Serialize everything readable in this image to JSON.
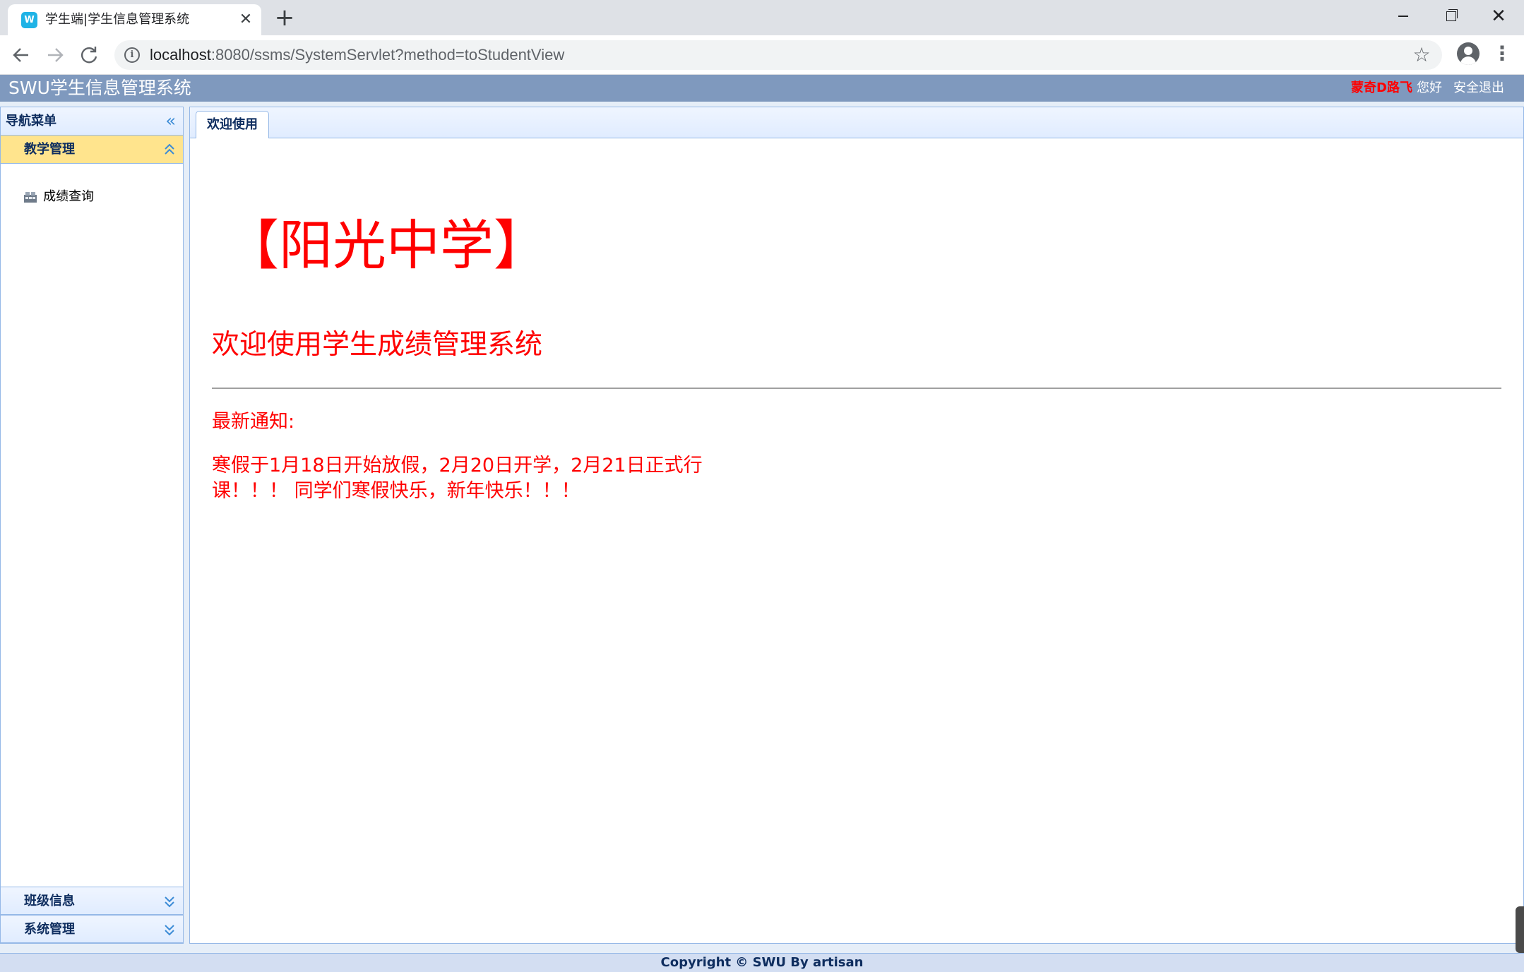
{
  "browser": {
    "tab_title": "学生端|学生信息管理系统",
    "tab_favicon": "swu-favicon-icon",
    "close_glyph": "✕",
    "new_tab_glyph": "+",
    "url_host": "localhost",
    "url_rest": ":8080/ssms/SystemServlet?method=toStudentView",
    "icons": [
      "back-arrow-icon",
      "forward-arrow-icon",
      "reload-icon",
      "info-icon",
      "star-icon",
      "profile-icon",
      "more-menu-icon"
    ]
  },
  "header": {
    "title": "SWU学生信息管理系统",
    "user_name": "蒙奇D路飞",
    "greeting": "您好",
    "logout_label": "安全退出",
    "bg_color": "#7f99be"
  },
  "sidebar": {
    "title": "导航菜单",
    "sections": [
      {
        "label": "教学管理",
        "expanded": true,
        "items": [
          {
            "label": "成绩查询",
            "icon": "grade-query-icon"
          }
        ]
      },
      {
        "label": "班级信息",
        "expanded": false
      },
      {
        "label": "系统管理",
        "expanded": false
      }
    ]
  },
  "main": {
    "tabs": [
      {
        "label": "欢迎使用",
        "active": true
      }
    ],
    "school_name": "【阳光中学】",
    "welcome_text": "欢迎使用学生成绩管理系统",
    "notice_title": "最新通知:",
    "notice_body": "寒假于1月18日开始放假，2月20日开学，2月21日正式行课！！！ 同学们寒假快乐，新年快乐！！！",
    "text_color": "#ff0000"
  },
  "footer": {
    "text": "Copyright © SWU By artisan"
  }
}
